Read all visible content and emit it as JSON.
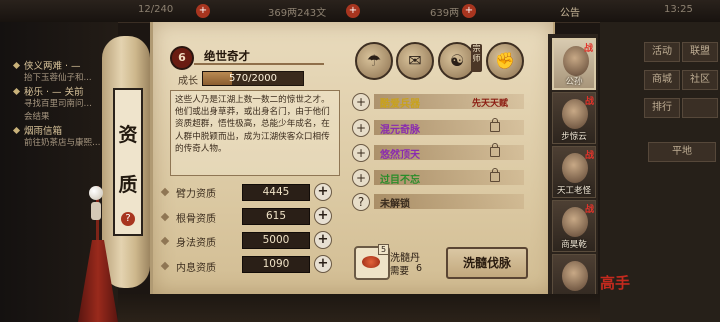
{
  "topbar": {
    "left_value": "12/240",
    "currency1": "369两243文",
    "currency2": "639两",
    "announce": "公告",
    "time": "13:25"
  },
  "quests": [
    {
      "title": "侠义两难 · —",
      "sub": "抬下玉蓉仙子和..."
    },
    {
      "title": "秘乐 · — 关前",
      "sub": "寻找百里司南问…"
    },
    {
      "title": "",
      "sub": "会结果"
    },
    {
      "title": "烟雨信箱",
      "sub": "前往奶茶店与康熙…"
    }
  ],
  "right_menu": {
    "btn1": "活动",
    "btn2": "联盟",
    "btn3": "商城",
    "btn4": "社区",
    "btn5": "排行",
    "btn6": "",
    "location": "平地"
  },
  "vertical_title": [
    "资",
    "质"
  ],
  "talent": {
    "badge": "6",
    "name": "绝世奇才",
    "growth_label": "成长",
    "growth_text": "570/2000",
    "growth_fraction": 0.285,
    "description": "这些人乃是江湖上数一数二的惊世之才。他们或出身草莽，或出身名门，由于他们资质超群，悟性极高，总能少年成名，在人群中脱颖而出，成为江湖侠客众口相传的传奇人物。"
  },
  "attributes": [
    {
      "label": "臂力资质",
      "value": "4445"
    },
    {
      "label": "根骨资质",
      "value": "615"
    },
    {
      "label": "身法资质",
      "value": "5000"
    },
    {
      "label": "内息资质",
      "value": "1090"
    }
  ],
  "skill_icons": [
    {
      "name": "hat-figure-icon",
      "glyph": "☂"
    },
    {
      "name": "scroll-icon",
      "glyph": "✉"
    },
    {
      "name": "yinyang-icon",
      "glyph": "☯"
    },
    {
      "name": "strongman-icon",
      "glyph": "✊"
    }
  ],
  "master_tag": "宗师",
  "talents": [
    {
      "name": "酷爱兵器",
      "color": "#c9a21c",
      "tag": "先天天赋",
      "lock": false
    },
    {
      "name": "混元奇脉",
      "color": "#8a2bb0",
      "tag": "",
      "lock": true
    },
    {
      "name": "悠然顶天",
      "color": "#8a2bb0",
      "tag": "",
      "lock": true
    },
    {
      "name": "过目不忘",
      "color": "#2a8d2a",
      "tag": "",
      "lock": true
    },
    {
      "name": "未解锁",
      "color": "#3a2c1e",
      "tag": "",
      "lock": false
    }
  ],
  "pill": {
    "count": "5",
    "name": "洗髓丹",
    "need_label": "需要",
    "need_value": "6"
  },
  "wash_button": "洗髓伐脉",
  "characters": [
    {
      "name": "公孙",
      "tag": "战"
    },
    {
      "name": "步惊云",
      "tag": "战"
    },
    {
      "name": "天工老怪",
      "tag": "战"
    },
    {
      "name": "商昊乾",
      "tag": "战"
    },
    {
      "name": "",
      "tag": ""
    }
  ],
  "seal": "高手"
}
